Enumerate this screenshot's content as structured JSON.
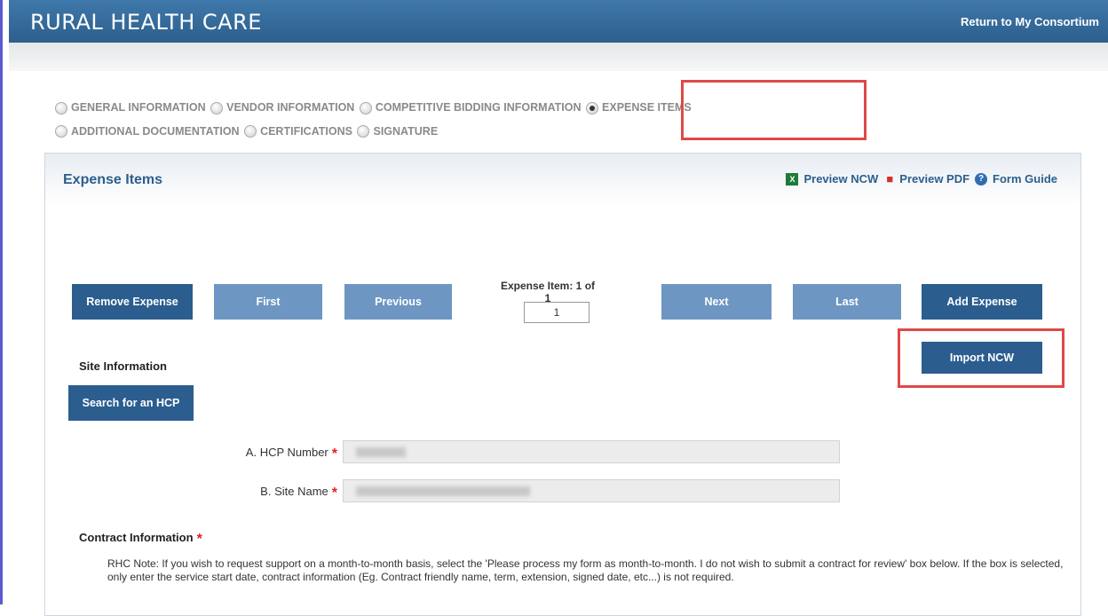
{
  "header": {
    "title": "RURAL HEALTH CARE",
    "return_link": "Return to My Consortium"
  },
  "steps": [
    {
      "label": "GENERAL INFORMATION",
      "selected": false
    },
    {
      "label": "VENDOR INFORMATION",
      "selected": false
    },
    {
      "label": "COMPETITIVE BIDDING INFORMATION",
      "selected": false
    },
    {
      "label": "EXPENSE ITEMS",
      "selected": true
    },
    {
      "label": "ADDITIONAL DOCUMENTATION",
      "selected": false
    },
    {
      "label": "CERTIFICATIONS",
      "selected": false
    },
    {
      "label": "SIGNATURE",
      "selected": false
    }
  ],
  "panel": {
    "title": "Expense Items",
    "preview_ncw": "Preview NCW",
    "preview_pdf": "Preview PDF",
    "form_guide": "Form Guide"
  },
  "pager": {
    "remove_expense": "Remove Expense",
    "first": "First",
    "previous": "Previous",
    "label": "Expense Item: 1 of 1",
    "current": "1",
    "next": "Next",
    "last": "Last",
    "add_expense": "Add Expense",
    "import_ncw": "Import NCW"
  },
  "site": {
    "heading": "Site Information",
    "search_button": "Search for an HCP",
    "hcp_number_label": "A. HCP Number",
    "site_name_label": "B. Site Name",
    "required_mark": "*"
  },
  "contract": {
    "heading": "Contract Information",
    "note": "RHC Note: If you wish to request support on a month-to-month basis, select the 'Please process my form as month-to-month. I do not wish to submit a contract for review' box below. If the box is selected, only enter the service start date, contract information (Eg. Contract friendly name, term, extension, signed date, etc...) is not required."
  },
  "colors": {
    "header": "#2c5f8c",
    "button_dark": "#2b5d8f",
    "button_light": "#6d96c2",
    "highlight": "#e04848",
    "required": "#dd2222"
  },
  "icons": {
    "excel": "excel-icon",
    "pdf": "pdf-icon",
    "help": "help-icon"
  }
}
